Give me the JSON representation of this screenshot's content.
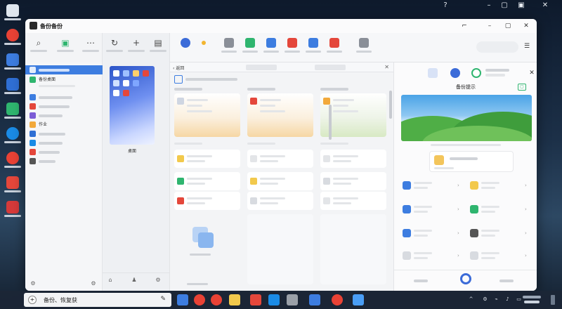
{
  "desktop_icons": [
    {
      "icon": "recycle-bin-icon",
      "color": "#dfe6ee",
      "shape": "square"
    },
    {
      "icon": "chrome-icon",
      "color": "#e94235",
      "shape": "round"
    },
    {
      "icon": "folder-blue-icon",
      "color": "#3d7de0",
      "shape": "square"
    },
    {
      "icon": "folder-blue-icon",
      "color": "#2f6fd4",
      "shape": "square"
    },
    {
      "icon": "green-app-icon",
      "color": "#2fb56f",
      "shape": "square"
    },
    {
      "icon": "edge-icon",
      "color": "#1a8be6",
      "shape": "round"
    },
    {
      "icon": "chrome-icon",
      "color": "#e94235",
      "shape": "round"
    },
    {
      "icon": "mail-icon",
      "color": "#e4473b",
      "shape": "square"
    },
    {
      "icon": "red-app-icon",
      "color": "#d63a3a",
      "shape": "square"
    }
  ],
  "window": {
    "title": "备份备份",
    "accent": "#3d7de0"
  },
  "sidebar": {
    "active_label": "",
    "items": [
      {
        "label": "备份桌面",
        "icon_color": "#2fb56f",
        "highlight": false
      },
      {
        "label": "",
        "icon_color": "#3d7de0"
      },
      {
        "label": "",
        "icon_color": "#e4473b"
      },
      {
        "label": "",
        "icon_color": "#7b5cd6"
      },
      {
        "label": "作业",
        "icon_color": "#f2a93b"
      },
      {
        "label": "",
        "icon_color": "#2f6fd4"
      },
      {
        "label": "",
        "icon_color": "#1a8be6"
      },
      {
        "label": "",
        "icon_color": "#e4473b"
      },
      {
        "label": "",
        "icon_color": "#555555"
      }
    ]
  },
  "thumbnail": {
    "label": "桌面"
  },
  "ribbon_icons": [
    {
      "icon": "gear-icon",
      "color": "#3b6bd8"
    },
    {
      "icon": "dot-icon",
      "color": "#f2b530"
    },
    {
      "icon": "grid-icon",
      "color": "#8a8f98"
    },
    {
      "icon": "doc-check-icon",
      "color": "#2fb56f"
    },
    {
      "icon": "doc-icon",
      "color": "#3d7de0"
    },
    {
      "icon": "share-icon",
      "color": "#e4473b"
    },
    {
      "icon": "monitor-icon",
      "color": "#3d7de0"
    },
    {
      "icon": "phone-icon",
      "color": "#e4473b"
    },
    {
      "icon": "network-icon",
      "color": "#8a8f98"
    }
  ],
  "content": {
    "back": "‹ 返回",
    "panel_title": "",
    "panel_foot": "",
    "panel_colors": [
      "amber",
      "amber",
      "green"
    ]
  },
  "right_pane": {
    "section_title": "备份提示",
    "card_title": "",
    "card_sub": "",
    "foot_left": "",
    "foot_right": ""
  },
  "taskbar": {
    "search_text": "备份、恢复获",
    "time": "",
    "date": "",
    "apps": [
      {
        "icon": "widgets-icon",
        "color": "#3d7de0",
        "shape": "square"
      },
      {
        "icon": "chrome-icon",
        "color": "#e94235",
        "shape": "round"
      },
      {
        "icon": "chrome-icon",
        "color": "#e94235",
        "shape": "round"
      },
      {
        "icon": "notes-icon",
        "color": "#f2c94c",
        "shape": "square"
      },
      {
        "icon": "office-icon",
        "color": "#e4473b",
        "shape": "square"
      },
      {
        "icon": "store-icon",
        "color": "#1a8be6",
        "shape": "square"
      },
      {
        "icon": "box-icon",
        "color": "#9aa0a8",
        "shape": "square"
      },
      {
        "icon": "tool-icon",
        "color": "#3d7de0",
        "shape": "square"
      },
      {
        "icon": "chrome-icon",
        "color": "#e94235",
        "shape": "round"
      },
      {
        "icon": "compass-icon",
        "color": "#4a9ef5",
        "shape": "square"
      }
    ]
  }
}
